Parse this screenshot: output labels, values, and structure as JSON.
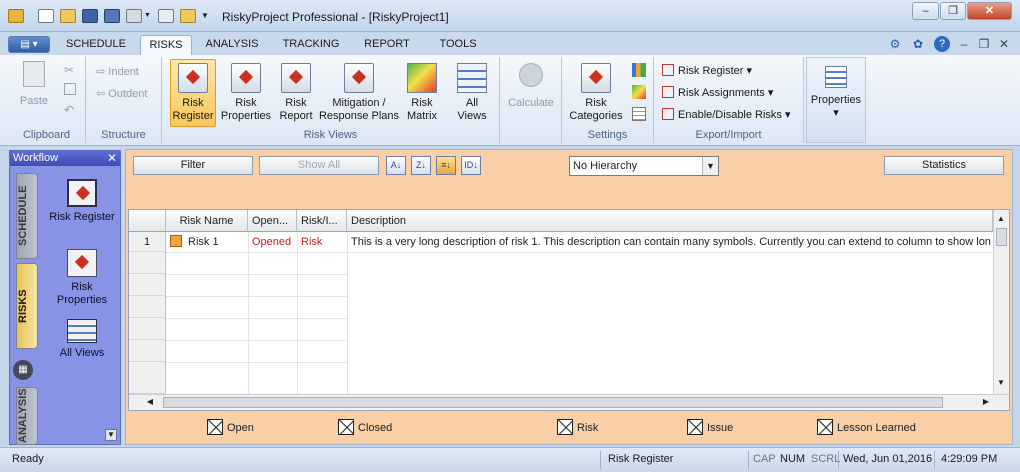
{
  "window": {
    "title": "RiskyProject Professional - [RiskyProject1]",
    "minimize_symbol": "–",
    "maximize_symbol": "❐",
    "close_symbol": "✕"
  },
  "menu_tabs": [
    "SCHEDULE",
    "RISKS",
    "ANALYSIS",
    "TRACKING",
    "REPORT",
    "TOOLS"
  ],
  "active_tab": "RISKS",
  "ribbon": {
    "clipboard": {
      "paste": "Paste",
      "group": "Clipboard"
    },
    "structure": {
      "indent": "Indent",
      "outdent": "Outdent",
      "group": "Structure"
    },
    "risk_views": {
      "risk_register": [
        "Risk",
        "Register"
      ],
      "risk_properties": [
        "Risk",
        "Properties"
      ],
      "risk_report": [
        "Risk",
        "Report"
      ],
      "mitigation": [
        "Mitigation /",
        "Response Plans"
      ],
      "risk_matrix": [
        "Risk",
        "Matrix"
      ],
      "all_views": [
        "All",
        "Views"
      ],
      "group": "Risk Views"
    },
    "calculate": "Calculate",
    "settings": {
      "risk_categories": [
        "Risk",
        "Categories"
      ],
      "group": "Settings"
    },
    "export_import": {
      "risk_register": "Risk Register",
      "risk_assignments": "Risk Assignments",
      "enable_disable": "Enable/Disable Risks",
      "group": "Export/Import"
    },
    "properties": "Properties"
  },
  "workflow": {
    "title": "Workflow",
    "close_symbol": "✕",
    "tabs": {
      "schedule": "SCHEDULE",
      "risks": "RISKS",
      "analysis": "ANALYSIS"
    },
    "items": {
      "risk_register": "Risk Register",
      "risk_properties": [
        "Risk",
        "Properties"
      ],
      "all_views": "All Views"
    }
  },
  "toolbar": {
    "filter": "Filter",
    "show_all": "Show All",
    "hierarchy": "No Hierarchy",
    "statistics": "Statistics"
  },
  "grid": {
    "columns": [
      "Risk Name",
      "Open...",
      "Risk/I...",
      "Description"
    ],
    "rows": [
      {
        "num": "1",
        "name": "Risk 1",
        "status": "Opened",
        "type": "Risk",
        "description": "This is a very long description of risk 1. This description can contain many symbols. Currently you can extend to column to show lon"
      }
    ]
  },
  "legend": [
    "Open",
    "Closed",
    "Risk",
    "Issue",
    "Lesson Learned"
  ],
  "statusbar": {
    "left": "Ready",
    "view": "Risk Register",
    "cap": "CAP",
    "num": "NUM",
    "scrl": "SCRL",
    "date": "Wed, Jun 01,2016",
    "time": "4:29:09 PM"
  },
  "colors": {
    "accent_red": "#d11a1a",
    "selected_tab": "#f9c65a",
    "panel_orange": "#f9cfa8",
    "workflow_blue": "#8893e6"
  }
}
